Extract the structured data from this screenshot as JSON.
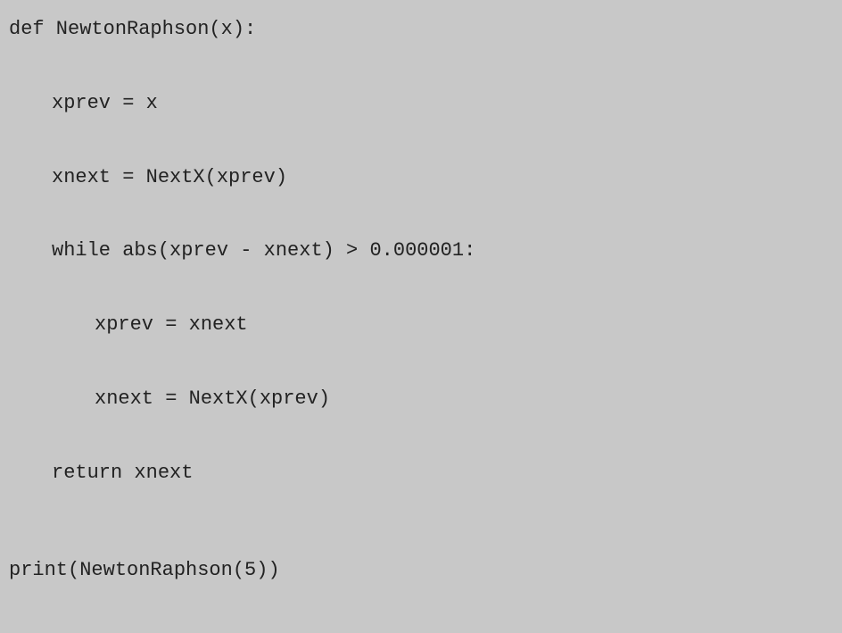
{
  "code": {
    "line1": "def NewtonRaphson(x):",
    "line2": "xprev = x",
    "line3": "xnext = NextX(xprev)",
    "line4": "while abs(xprev - xnext) > 0.000001:",
    "line5": "xprev = xnext",
    "line6": "xnext = NextX(xprev)",
    "line7": "return xnext",
    "line8": "print(NewtonRaphson(5))"
  }
}
